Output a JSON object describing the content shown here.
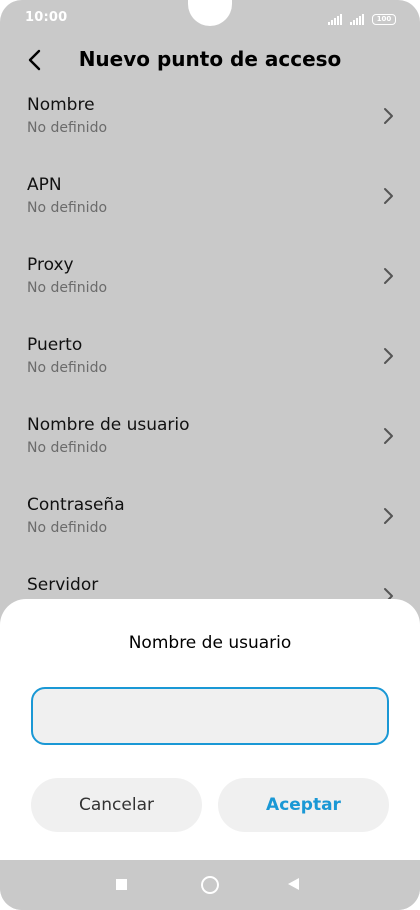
{
  "status_bar": {
    "time": "10:00",
    "battery": "100"
  },
  "header": {
    "title": "Nuevo punto de acceso",
    "back_icon": "chevron-left-icon"
  },
  "list": {
    "items": [
      {
        "title": "Nombre",
        "value": "No definido"
      },
      {
        "title": "APN",
        "value": "No definido"
      },
      {
        "title": "Proxy",
        "value": "No definido"
      },
      {
        "title": "Puerto",
        "value": "No definido"
      },
      {
        "title": "Nombre de usuario",
        "value": "No definido"
      },
      {
        "title": "Contraseña",
        "value": "No definido"
      },
      {
        "title": "Servidor",
        "value": ""
      }
    ]
  },
  "dialog": {
    "title": "Nombre de usuario",
    "input_value": "",
    "cancel_label": "Cancelar",
    "accept_label": "Aceptar"
  },
  "colors": {
    "accent": "#1a98d5",
    "overlay_background": "#c9c9c9",
    "dialog_background": "#ffffff",
    "button_background": "#f0f0f0"
  }
}
